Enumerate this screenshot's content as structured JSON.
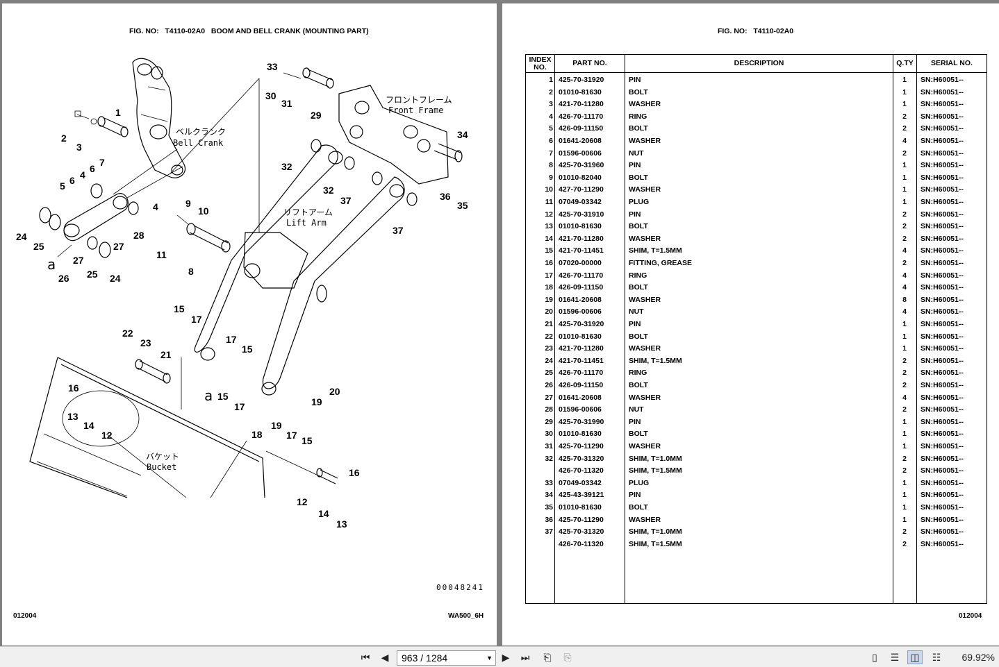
{
  "left_page": {
    "fig_no_label": "FIG. NO:",
    "fig_no": "T4110-02A0",
    "fig_title": "BOOM AND BELL CRANK (MOUNTING PART)",
    "page_code": "012004",
    "model": "WA500_6H",
    "drawing_no": "00048241",
    "callouts": [
      "1",
      "2",
      "3",
      "4",
      "5",
      "6",
      "7",
      "8",
      "9",
      "10",
      "11",
      "12",
      "13",
      "14",
      "15",
      "16",
      "17",
      "18",
      "19",
      "20",
      "21",
      "22",
      "23",
      "24",
      "25",
      "26",
      "27",
      "28",
      "29",
      "30",
      "31",
      "32",
      "33",
      "34",
      "35",
      "36",
      "37"
    ],
    "annotations": {
      "bell_crank_jp": "ベルクランク",
      "bell_crank": "Bell Crank",
      "front_frame_jp": "フロントフレーム",
      "front_frame": "Front Frame",
      "lift_arm_jp": "リフトアーム",
      "lift_arm": "Lift Arm",
      "bucket_jp": "バケット",
      "bucket": "Bucket",
      "ref_a": "a"
    }
  },
  "right_page": {
    "fig_no_label": "FIG. NO:",
    "fig_no": "T4110-02A0",
    "page_code": "012004",
    "columns": [
      "INDEX NO.",
      "PART NO.",
      "DESCRIPTION",
      "Q.TY",
      "SERIAL NO."
    ],
    "rows": [
      {
        "idx": "1",
        "part": "425-70-31920",
        "desc": "PIN",
        "qty": "1",
        "sn": "SN:H60051--"
      },
      {
        "idx": "2",
        "part": "01010-81630",
        "desc": "BOLT",
        "qty": "1",
        "sn": "SN:H60051--"
      },
      {
        "idx": "3",
        "part": "421-70-11280",
        "desc": "WASHER",
        "qty": "1",
        "sn": "SN:H60051--"
      },
      {
        "idx": "4",
        "part": "426-70-11170",
        "desc": "RING",
        "qty": "2",
        "sn": "SN:H60051--"
      },
      {
        "idx": "5",
        "part": "426-09-11150",
        "desc": "BOLT",
        "qty": "2",
        "sn": "SN:H60051--"
      },
      {
        "idx": "6",
        "part": "01641-20608",
        "desc": "WASHER",
        "qty": "4",
        "sn": "SN:H60051--"
      },
      {
        "idx": "7",
        "part": "01596-00606",
        "desc": "NUT",
        "qty": "2",
        "sn": "SN:H60051--"
      },
      {
        "idx": "8",
        "part": "425-70-31960",
        "desc": "PIN",
        "qty": "1",
        "sn": "SN:H60051--"
      },
      {
        "idx": "9",
        "part": "01010-82040",
        "desc": "BOLT",
        "qty": "1",
        "sn": "SN:H60051--"
      },
      {
        "idx": "10",
        "part": "427-70-11290",
        "desc": "WASHER",
        "qty": "1",
        "sn": "SN:H60051--"
      },
      {
        "idx": "11",
        "part": "07049-03342",
        "desc": "PLUG",
        "qty": "1",
        "sn": "SN:H60051--"
      },
      {
        "idx": "12",
        "part": "425-70-31910",
        "desc": "PIN",
        "qty": "2",
        "sn": "SN:H60051--"
      },
      {
        "idx": "13",
        "part": "01010-81630",
        "desc": "BOLT",
        "qty": "2",
        "sn": "SN:H60051--"
      },
      {
        "idx": "14",
        "part": "421-70-11280",
        "desc": "WASHER",
        "qty": "2",
        "sn": "SN:H60051--"
      },
      {
        "idx": "15",
        "part": "421-70-11451",
        "desc": "SHIM, T=1.5MM",
        "qty": "4",
        "sn": "SN:H60051--"
      },
      {
        "idx": "16",
        "part": "07020-00000",
        "desc": "FITTING, GREASE",
        "qty": "2",
        "sn": "SN:H60051--"
      },
      {
        "idx": "17",
        "part": "426-70-11170",
        "desc": "RING",
        "qty": "4",
        "sn": "SN:H60051--"
      },
      {
        "idx": "18",
        "part": "426-09-11150",
        "desc": "BOLT",
        "qty": "4",
        "sn": "SN:H60051--"
      },
      {
        "idx": "19",
        "part": "01641-20608",
        "desc": "WASHER",
        "qty": "8",
        "sn": "SN:H60051--"
      },
      {
        "idx": "20",
        "part": "01596-00606",
        "desc": "NUT",
        "qty": "4",
        "sn": "SN:H60051--"
      },
      {
        "idx": "21",
        "part": "425-70-31920",
        "desc": "PIN",
        "qty": "1",
        "sn": "SN:H60051--"
      },
      {
        "idx": "22",
        "part": "01010-81630",
        "desc": "BOLT",
        "qty": "1",
        "sn": "SN:H60051--"
      },
      {
        "idx": "23",
        "part": "421-70-11280",
        "desc": "WASHER",
        "qty": "1",
        "sn": "SN:H60051--"
      },
      {
        "idx": "24",
        "part": "421-70-11451",
        "desc": "SHIM, T=1.5MM",
        "qty": "2",
        "sn": "SN:H60051--"
      },
      {
        "idx": "25",
        "part": "426-70-11170",
        "desc": "RING",
        "qty": "2",
        "sn": "SN:H60051--"
      },
      {
        "idx": "26",
        "part": "426-09-11150",
        "desc": "BOLT",
        "qty": "2",
        "sn": "SN:H60051--"
      },
      {
        "idx": "27",
        "part": "01641-20608",
        "desc": "WASHER",
        "qty": "4",
        "sn": "SN:H60051--"
      },
      {
        "idx": "28",
        "part": "01596-00606",
        "desc": "NUT",
        "qty": "2",
        "sn": "SN:H60051--"
      },
      {
        "idx": "29",
        "part": "425-70-31990",
        "desc": "PIN",
        "qty": "1",
        "sn": "SN:H60051--"
      },
      {
        "idx": "30",
        "part": "01010-81630",
        "desc": "BOLT",
        "qty": "1",
        "sn": "SN:H60051--"
      },
      {
        "idx": "31",
        "part": "425-70-11290",
        "desc": "WASHER",
        "qty": "1",
        "sn": "SN:H60051--"
      },
      {
        "idx": "32",
        "part": "425-70-31320",
        "desc": "SHIM, T=1.0MM",
        "qty": "2",
        "sn": "SN:H60051--"
      },
      {
        "idx": "",
        "part": "426-70-11320",
        "desc": "SHIM, T=1.5MM",
        "qty": "2",
        "sn": "SN:H60051--"
      },
      {
        "idx": "33",
        "part": "07049-03342",
        "desc": "PLUG",
        "qty": "1",
        "sn": "SN:H60051--"
      },
      {
        "idx": "34",
        "part": "425-43-39121",
        "desc": "PIN",
        "qty": "1",
        "sn": "SN:H60051--"
      },
      {
        "idx": "35",
        "part": "01010-81630",
        "desc": "BOLT",
        "qty": "1",
        "sn": "SN:H60051--"
      },
      {
        "idx": "36",
        "part": "425-70-11290",
        "desc": "WASHER",
        "qty": "1",
        "sn": "SN:H60051--"
      },
      {
        "idx": "37",
        "part": "425-70-31320",
        "desc": "SHIM, T=1.0MM",
        "qty": "2",
        "sn": "SN:H60051--"
      },
      {
        "idx": "",
        "part": "426-70-11320",
        "desc": "SHIM, T=1.5MM",
        "qty": "2",
        "sn": "SN:H60051--"
      }
    ]
  },
  "toolbar": {
    "page_indicator": "963 / 1284",
    "zoom": "69.92%",
    "icons": [
      "first-page-icon",
      "prev-page-icon",
      "next-page-icon",
      "last-page-icon",
      "go-back-icon",
      "go-forward-icon",
      "single-page-icon",
      "continuous-icon",
      "facing-icon",
      "facing-continuous-icon"
    ]
  }
}
